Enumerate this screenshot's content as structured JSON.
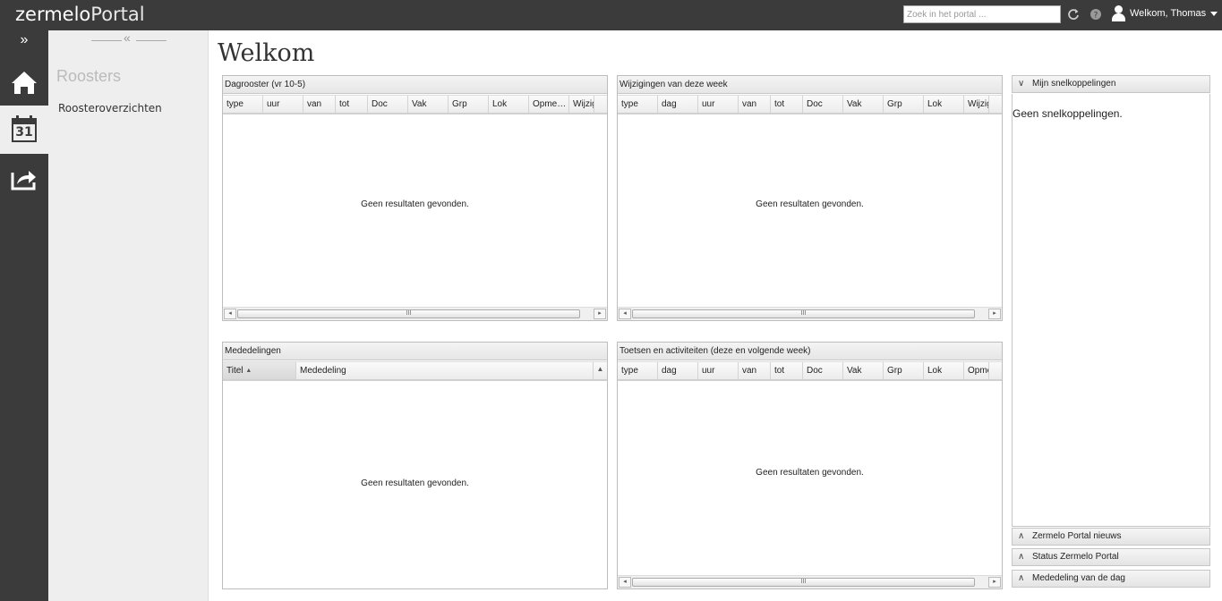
{
  "app": {
    "logo_bold": "zermelo",
    "logo_light": "Portal",
    "search_placeholder": "Zoek in het portal ...",
    "user_label": "Welkom, Thomas"
  },
  "sidebar": {
    "section_title": "Roosters",
    "items": [
      {
        "label": "Roosteroverzichten"
      }
    ],
    "nav": [
      {
        "name": "home",
        "icon": "home-icon"
      },
      {
        "name": "calendar",
        "icon": "calendar-icon",
        "label": "31",
        "active": true
      },
      {
        "name": "share",
        "icon": "share-icon"
      }
    ]
  },
  "page": {
    "title": "Welkom"
  },
  "panels": {
    "dagrooster": {
      "title": "Dagrooster (vr 10-5)",
      "columns": [
        "type",
        "uur",
        "van",
        "tot",
        "Doc",
        "Vak",
        "Grp",
        "Lok",
        "Opme…",
        "Wijzig"
      ],
      "empty": "Geen resultaten gevonden."
    },
    "wijzigingen": {
      "title": "Wijzigingen van deze week",
      "columns": [
        "type",
        "dag",
        "uur",
        "van",
        "tot",
        "Doc",
        "Vak",
        "Grp",
        "Lok",
        "Wijzig"
      ],
      "empty": "Geen resultaten gevonden."
    },
    "mededelingen": {
      "title": "Mededelingen",
      "columns": [
        "Titel",
        "Mededeling"
      ],
      "sort_indicator": "▲",
      "empty": "Geen resultaten gevonden."
    },
    "toetsen": {
      "title": "Toetsen en activiteiten (deze en volgende week)",
      "columns": [
        "type",
        "dag",
        "uur",
        "van",
        "tot",
        "Doc",
        "Vak",
        "Grp",
        "Lok",
        "Opme"
      ],
      "empty": "Geen resultaten gevonden."
    }
  },
  "side_panels": {
    "snelkoppelingen": {
      "title": "Mijn snelkoppelingen",
      "body": "Geen snelkoppelingen.",
      "expanded": true
    },
    "nieuws": {
      "title": "Zermelo Portal nieuws"
    },
    "status": {
      "title": "Status Zermelo Portal"
    },
    "mededeling_dag": {
      "title": "Mededeling van de dag"
    }
  },
  "colors": {
    "topbar": "#3b3b3b",
    "sidebar": "#eeeeee"
  }
}
